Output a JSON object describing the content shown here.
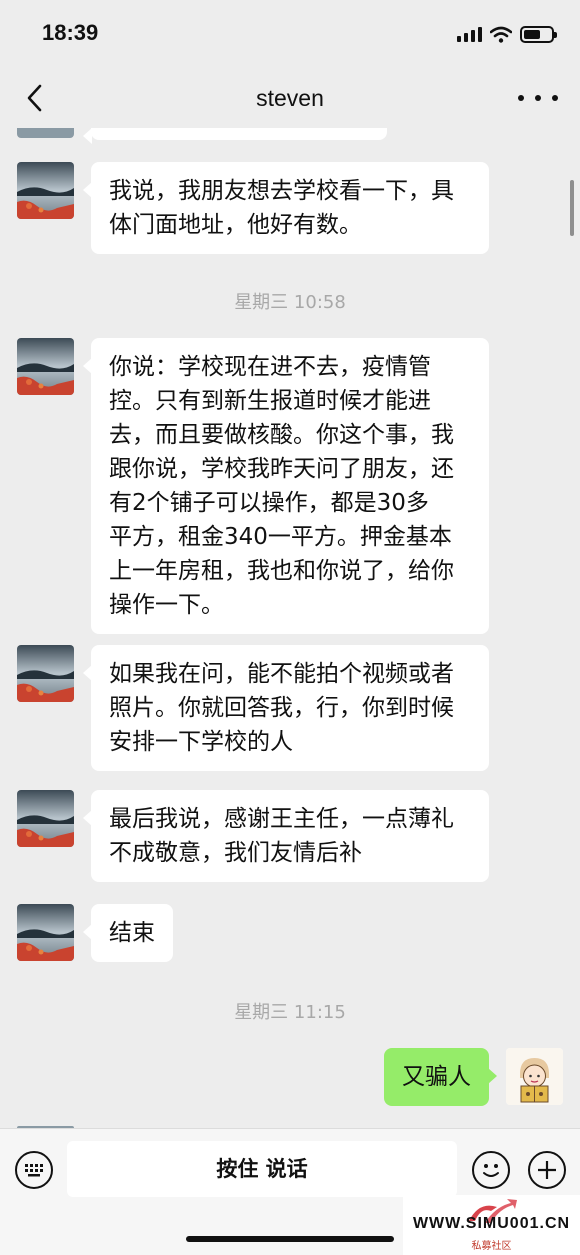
{
  "status_bar": {
    "time": "18:39"
  },
  "nav": {
    "title": "steven"
  },
  "messages": [
    {
      "type": "incoming",
      "text": "我说，我朋友想去学校看一下，具\n体门面地址，他好有数。"
    },
    {
      "type": "timestamp",
      "text": "星期三 10:58"
    },
    {
      "type": "incoming",
      "text": "你说：学校现在进不去，疫情管\n控。只有到新生报道时候才能进\n去，而且要做核酸。你这个事，我\n跟你说，学校我昨天问了朋友，还\n有2个铺子可以操作，都是30多\n平方，租金340一平方。押金基本\n上一年房租，我也和你说了，给你\n操作一下。"
    },
    {
      "type": "incoming",
      "text": "如果我在问，能不能拍个视频或者\n照片。你就回答我，行，你到时候\n安排一下学校的人"
    },
    {
      "type": "incoming",
      "text": "最后我说，感谢王主任，一点薄礼\n不成敬意，我们友情后补"
    },
    {
      "type": "incoming",
      "text": "结束"
    },
    {
      "type": "timestamp",
      "text": "星期三 11:15"
    },
    {
      "type": "outgoing",
      "text": "又骗人"
    }
  ],
  "input_bar": {
    "hold_to_talk_label": "按住 说话"
  },
  "watermark": {
    "url": "WWW.SIMU001.CN",
    "subtitle": "私募社区"
  },
  "colors": {
    "background": "#ededed",
    "incoming_bubble": "#ffffff",
    "outgoing_bubble": "#95ec69",
    "timestamp_text": "#a8a8a8"
  }
}
